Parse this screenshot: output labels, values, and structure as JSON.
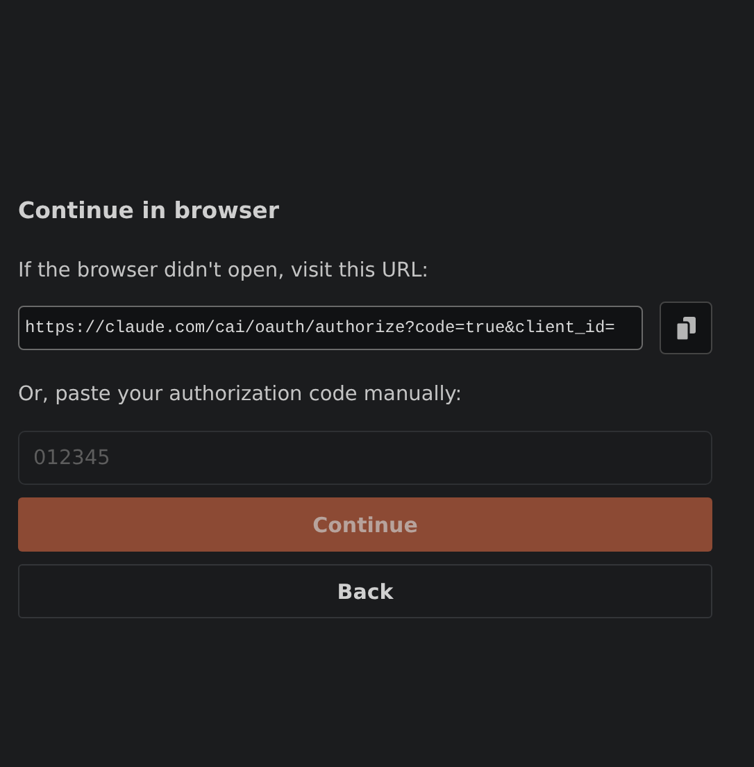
{
  "title": "Continue in browser",
  "url_prompt": "If the browser didn't open, visit this URL:",
  "url_field": {
    "value": "https://claude.com/cai/oauth/authorize?code=true&client_id="
  },
  "code_prompt": "Or, paste your authorization code manually:",
  "code_field": {
    "placeholder": "012345"
  },
  "buttons": [
    {
      "kind": "primary",
      "label": "Continue",
      "disabled": true
    },
    {
      "kind": "secondary",
      "label": "Back",
      "disabled": false
    }
  ]
}
